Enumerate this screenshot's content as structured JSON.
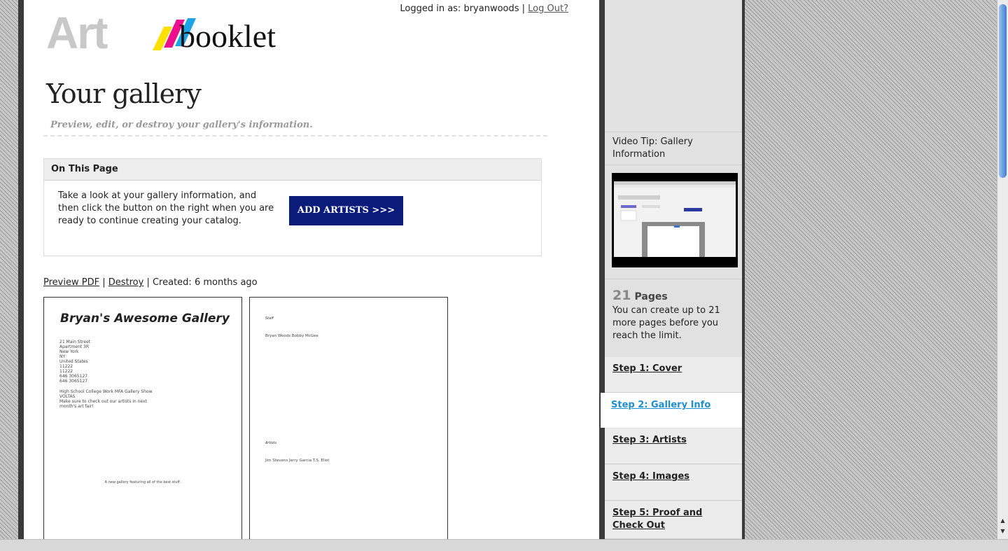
{
  "header": {
    "logged_in_text": "Logged in as: bryanwoods |",
    "logout_label": "Log Out?"
  },
  "logo": {
    "art": "Art",
    "booklet": "booklet"
  },
  "page": {
    "title": "Your gallery",
    "subtitle": "Preview, edit, or destroy your gallery's information."
  },
  "on_this_page": {
    "heading": "On This Page",
    "text": "Take a look at your gallery information, and then click the button on the right when you are ready to continue creating your catalog.",
    "button_label": "ADD ARTISTS >>>"
  },
  "actions": {
    "preview_label": "Preview PDF",
    "sep1": " | ",
    "destroy_label": "Destroy",
    "sep2": " | ",
    "created": "Created: 6 months ago"
  },
  "preview": {
    "page1": {
      "title": "Bryan's Awesome Gallery",
      "address_lines": [
        "21 Main Street",
        "Apartment 3R",
        "New York",
        "NY",
        "United States",
        "11222",
        "11222",
        "646 3065127",
        "646 3065127"
      ],
      "show_lines": [
        "High School College Work MFA Gallery Show",
        "VOLTAS",
        "Make sure to check out our artists in next month's art fair!"
      ],
      "footer": "A new gallery featuring all of the best stuff."
    },
    "page2": {
      "staff_heading": "Staff",
      "staff_names": "Bryan Woods Bobby McGee",
      "artists_heading": "Artists",
      "artist_names": "Jim Stevens Jerry Garcia T.S. Eliot"
    }
  },
  "sidebar": {
    "video_tip": "Video Tip: Gallery Information",
    "pages_count": "21",
    "pages_word": "Pages",
    "pages_desc": "You can create up to 21 more pages before you reach the limit.",
    "steps": [
      {
        "label": "Step 1: Cover"
      },
      {
        "label": "Step 2: Gallery Info"
      },
      {
        "label": "Step 3: Artists"
      },
      {
        "label": "Step 4: Images"
      },
      {
        "label": "Step 5: Proof and Check Out"
      }
    ]
  },
  "colors": {
    "button_bg": "#0b1b7a",
    "active_step": "#1e8fd0",
    "logo_yellow": "#ffe000",
    "logo_magenta": "#ec0f8c",
    "logo_cyan": "#1ea3e6"
  }
}
